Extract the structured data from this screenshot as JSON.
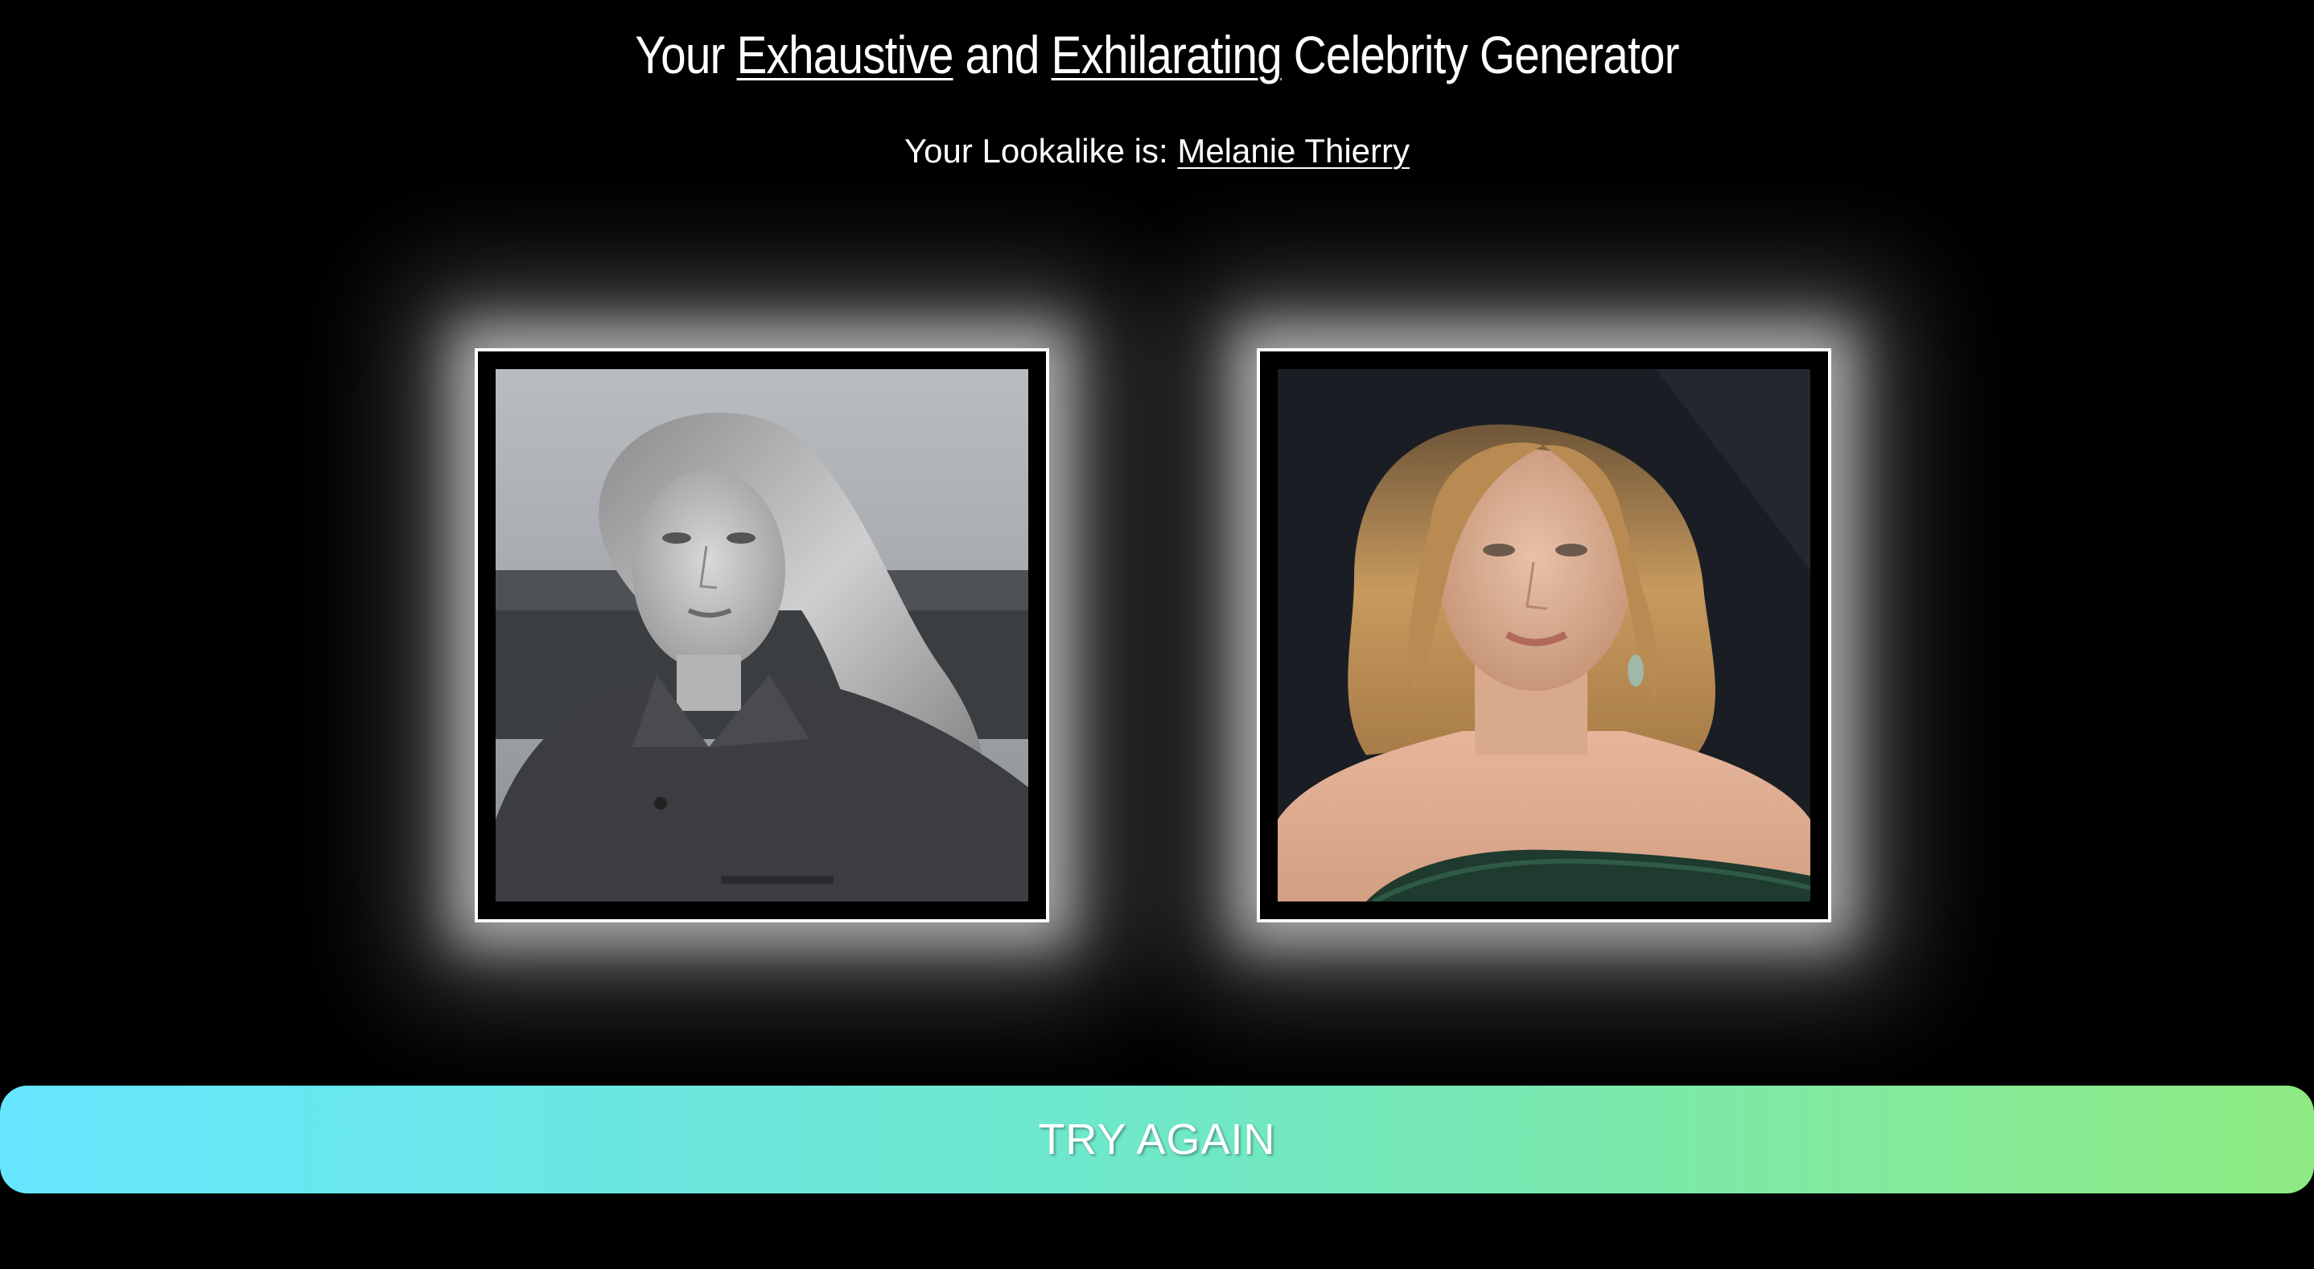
{
  "header": {
    "title_pre": "Your",
    "title_word1": "Exhaustive",
    "title_mid": "and",
    "title_word2": "Exhilarating",
    "title_post": "Celebrity Generator"
  },
  "result": {
    "label": "Your Lookalike is:",
    "celebrity_name": "Melanie Thierry"
  },
  "photos": {
    "user_photo": "user-uploaded-photo",
    "celebrity_photo": "celebrity-lookalike-photo"
  },
  "actions": {
    "try_again_label": "TRY AGAIN"
  },
  "colors": {
    "background": "#000000",
    "text": "#ffffff",
    "button_gradient_start": "#66e6ff",
    "button_gradient_end": "#8eea82"
  }
}
